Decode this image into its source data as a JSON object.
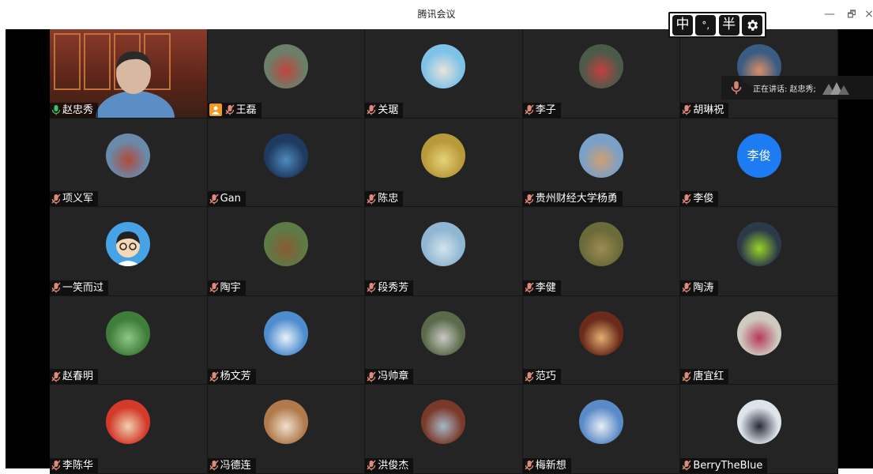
{
  "window": {
    "title": "腾讯会议",
    "minimize_glyph": "—",
    "maximize_glyph": "🗗",
    "close_glyph": "×"
  },
  "ime": {
    "mode": "中",
    "punct": "°,",
    "width": "半",
    "settings_icon": "gear-icon"
  },
  "speaking": {
    "label": "正在讲话: 赵忠秀;"
  },
  "colors": {
    "grid_bg": "#242424",
    "host_badge": "#f39a21",
    "muted_mic": "#e08a7a",
    "active_mic": "#3ec46d",
    "text_avatar_bg": "#1e7cf2"
  },
  "participants": [
    {
      "name": "赵忠秀",
      "mic": "active",
      "host": false,
      "avatar": "video",
      "bg": "#8a3b2a",
      "fg": "#d8b8a0"
    },
    {
      "name": "王磊",
      "mic": "muted",
      "host": true,
      "avatar": "photo",
      "bg": "#6b7f69",
      "fg": "#c0453d"
    },
    {
      "name": "关琚",
      "mic": "muted",
      "host": false,
      "avatar": "photo",
      "bg": "#7fc2e8",
      "fg": "#e9e4d8"
    },
    {
      "name": "李子",
      "mic": "muted",
      "host": false,
      "avatar": "photo",
      "bg": "#4c5a4a",
      "fg": "#c24040"
    },
    {
      "name": "胡琳祝",
      "mic": "muted",
      "host": false,
      "avatar": "photo",
      "bg": "#3a5b82",
      "fg": "#d89066"
    },
    {
      "name": "项义军",
      "mic": "muted",
      "host": false,
      "avatar": "photo",
      "bg": "#6a8aaa",
      "fg": "#b04a3a"
    },
    {
      "name": "Gan",
      "mic": "muted",
      "host": false,
      "avatar": "photo",
      "bg": "#1e3a5f",
      "fg": "#4f8ac0"
    },
    {
      "name": "陈忠",
      "mic": "muted",
      "host": false,
      "avatar": "photo",
      "bg": "#b99a3a",
      "fg": "#e6d27a"
    },
    {
      "name": "贵州财经大学杨勇",
      "mic": "muted",
      "host": false,
      "avatar": "photo",
      "bg": "#7aa0c8",
      "fg": "#d0a070"
    },
    {
      "name": "李俊",
      "mic": "muted",
      "host": false,
      "avatar": "text",
      "initials": "李俊",
      "bg": "#1e7cf2",
      "fg": "#ffffff"
    },
    {
      "name": "一笑而过",
      "mic": "muted",
      "host": false,
      "avatar": "cartoon",
      "bg": "#47a3e6",
      "fg": "#f5d9b7"
    },
    {
      "name": "陶宇",
      "mic": "muted",
      "host": false,
      "avatar": "photo",
      "bg": "#5e7a45",
      "fg": "#8a5a34"
    },
    {
      "name": "段秀芳",
      "mic": "muted",
      "host": false,
      "avatar": "photo",
      "bg": "#8fb6d2",
      "fg": "#d4e4ee"
    },
    {
      "name": "李健",
      "mic": "muted",
      "host": false,
      "avatar": "photo",
      "bg": "#6a6a3a",
      "fg": "#9e8c52"
    },
    {
      "name": "陶涛",
      "mic": "muted",
      "host": false,
      "avatar": "photo",
      "bg": "#2c3a48",
      "fg": "#9ad42a"
    },
    {
      "name": "赵春明",
      "mic": "muted",
      "host": false,
      "avatar": "photo",
      "bg": "#3f7d3a",
      "fg": "#8fc785"
    },
    {
      "name": "杨文芳",
      "mic": "muted",
      "host": false,
      "avatar": "photo",
      "bg": "#4d8ccf",
      "fg": "#e9f2fa"
    },
    {
      "name": "冯帅章",
      "mic": "muted",
      "host": false,
      "avatar": "photo",
      "bg": "#5a6a4a",
      "fg": "#c9c9c4"
    },
    {
      "name": "范巧",
      "mic": "muted",
      "host": false,
      "avatar": "photo",
      "bg": "#6b2a1a",
      "fg": "#e0b070"
    },
    {
      "name": "唐宜红",
      "mic": "muted",
      "host": false,
      "avatar": "photo",
      "bg": "#cfcac0",
      "fg": "#b43a5a"
    },
    {
      "name": "李陈华",
      "mic": "muted",
      "host": false,
      "avatar": "photo",
      "bg": "#d33a2a",
      "fg": "#f1d0b0"
    },
    {
      "name": "冯德连",
      "mic": "muted",
      "host": false,
      "avatar": "photo",
      "bg": "#b07a4a",
      "fg": "#f0e0d0"
    },
    {
      "name": "洪俊杰",
      "mic": "muted",
      "host": false,
      "avatar": "photo",
      "bg": "#7a3a2a",
      "fg": "#a8b8c8"
    },
    {
      "name": "梅新想",
      "mic": "muted",
      "host": false,
      "avatar": "photo",
      "bg": "#5a8ac8",
      "fg": "#e8eef4"
    },
    {
      "name": "BerryTheBlue",
      "mic": "muted",
      "host": false,
      "avatar": "photo",
      "bg": "#dde4ea",
      "fg": "#2a2a3a"
    }
  ]
}
